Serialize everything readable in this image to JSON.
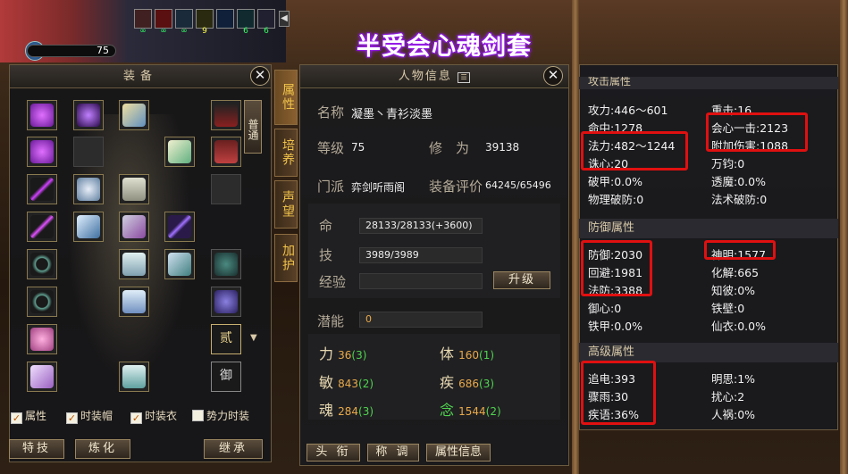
{
  "hud": {
    "level": "75",
    "buffs": [
      "∞",
      "∞",
      "∞",
      "9",
      "6",
      "6"
    ]
  },
  "banner_title": "半受会心魂剑套",
  "equip_panel": {
    "title": "装备",
    "side_toggle": "普通",
    "slot_buttons": [
      "贰",
      "御"
    ],
    "checkboxes": [
      {
        "label": "属性",
        "checked": true
      },
      {
        "label": "时装帽",
        "checked": true
      },
      {
        "label": "时装衣",
        "checked": true
      },
      {
        "label": "势力时装",
        "checked": false
      }
    ],
    "buttons": [
      "特技",
      "炼化",
      "继承"
    ]
  },
  "vertical_tabs": [
    "属性",
    "培养",
    "声望",
    "加护"
  ],
  "char_panel": {
    "title": "人物信息",
    "name_label": "名称",
    "name_value": "凝墨丶青衫淡墨",
    "level_label": "等级",
    "level_value": "75",
    "cult_label": "修　为",
    "cult_value": "39138",
    "sect_label": "门派",
    "sect_value": "弈剑听雨阁",
    "score_label": "装备评价",
    "score_value": "64245/65496",
    "life_label": "命",
    "life_value": "28133/28133(+3600)",
    "skill_label": "技",
    "skill_value": "3989/3989",
    "exp_label": "经验",
    "exp_value": "",
    "upgrade_button": "升级",
    "potential_label": "潜能",
    "potential_value": "0",
    "attrs": [
      {
        "label": "力",
        "value": "36",
        "extra": "(3)"
      },
      {
        "label": "体",
        "value": "160",
        "extra": "(1)"
      },
      {
        "label": "敏",
        "value": "843",
        "extra": "(2)"
      },
      {
        "label": "疾",
        "value": "686",
        "extra": "(3)"
      },
      {
        "label": "魂",
        "value": "284",
        "extra": "(3)"
      },
      {
        "label": "念",
        "value": "1544",
        "extra": "(2)"
      }
    ],
    "bottom_buttons": [
      "头 衔",
      "称 调",
      "属性信息"
    ]
  },
  "stats_panel": {
    "top_clip_header": "攻击属性",
    "attack": [
      [
        "攻力:446～601",
        "重击:16"
      ],
      [
        "命中:1278",
        "会心一击:2123"
      ],
      [
        "法力:482～1244",
        "附加伤害:1088"
      ],
      [
        "诛心:20",
        "万钧:0"
      ],
      [
        "破甲:0.0%",
        "透魔:0.0%"
      ],
      [
        "物理破防:0",
        "法术破防:0"
      ]
    ],
    "defense_header": "防御属性",
    "defense": [
      [
        "防御:2030",
        "神明:1577"
      ],
      [
        "回避:1981",
        "化解:665"
      ],
      [
        "法防:3388",
        "知彼:0%"
      ],
      [
        "御心:0",
        "铁壁:0"
      ],
      [
        "铁甲:0.0%",
        "仙衣:0.0%"
      ]
    ],
    "advanced_header": "高级属性",
    "advanced": [
      [
        "追电:393",
        "明思:1%"
      ],
      [
        "骤雨:30",
        "扰心:2"
      ],
      [
        "疾语:36%",
        "人祸:0%"
      ]
    ]
  },
  "colors": {
    "highlight_box": "#e01010",
    "banner_glow": "#a020f0",
    "gold_tab": "#f0c34a"
  }
}
